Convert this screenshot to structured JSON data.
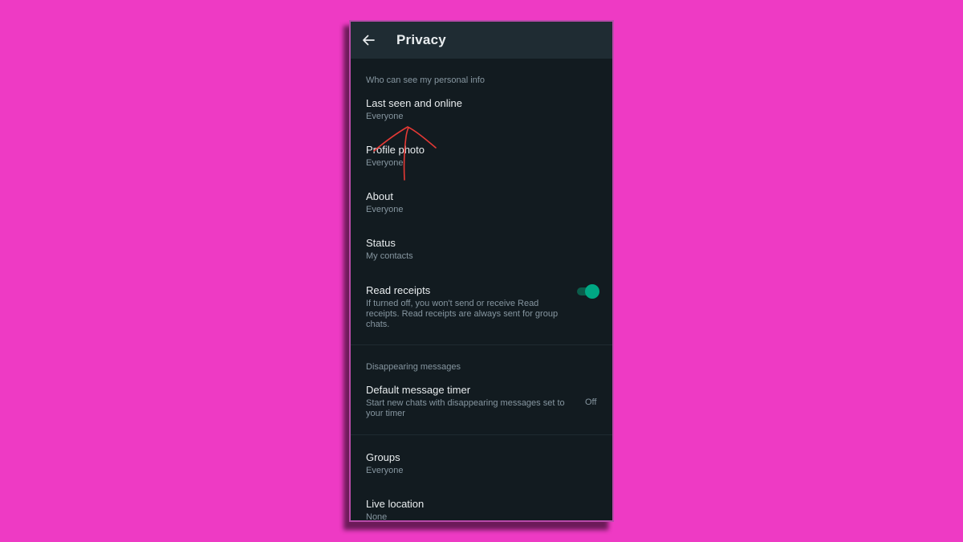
{
  "colors": {
    "background": "#ee3ac4",
    "screen": "#121b20",
    "app_bar": "#1f2c33",
    "text_primary": "#e9edef",
    "text_secondary": "#8696a0",
    "divider": "#1f2b31",
    "accent": "#00a884",
    "toggle_track": "#0b5d4b",
    "annotation": "#e53935",
    "frame": "#b84aa9"
  },
  "app_bar": {
    "back_icon": "arrow-left-icon",
    "title": "Privacy"
  },
  "personal_info": {
    "header": "Who can see my personal info",
    "items": [
      {
        "title": "Last seen and online",
        "value": "Everyone"
      },
      {
        "title": "Profile photo",
        "value": "Everyone"
      },
      {
        "title": "About",
        "value": "Everyone"
      },
      {
        "title": "Status",
        "value": "My contacts"
      }
    ],
    "read_receipts": {
      "title": "Read receipts",
      "description": "If turned off, you won't send or receive Read receipts. Read receipts are always sent for group chats.",
      "enabled": true
    }
  },
  "disappearing": {
    "header": "Disappearing messages",
    "default_timer": {
      "title": "Default message timer",
      "description": "Start new chats with disappearing messages set to your timer",
      "value": "Off"
    }
  },
  "more": {
    "items": [
      {
        "title": "Groups",
        "value": "Everyone"
      },
      {
        "title": "Live location",
        "value": "None"
      }
    ]
  },
  "annotation": {
    "type": "hand-drawn arrow",
    "color_name": "red",
    "points_to": "Last seen and online"
  }
}
